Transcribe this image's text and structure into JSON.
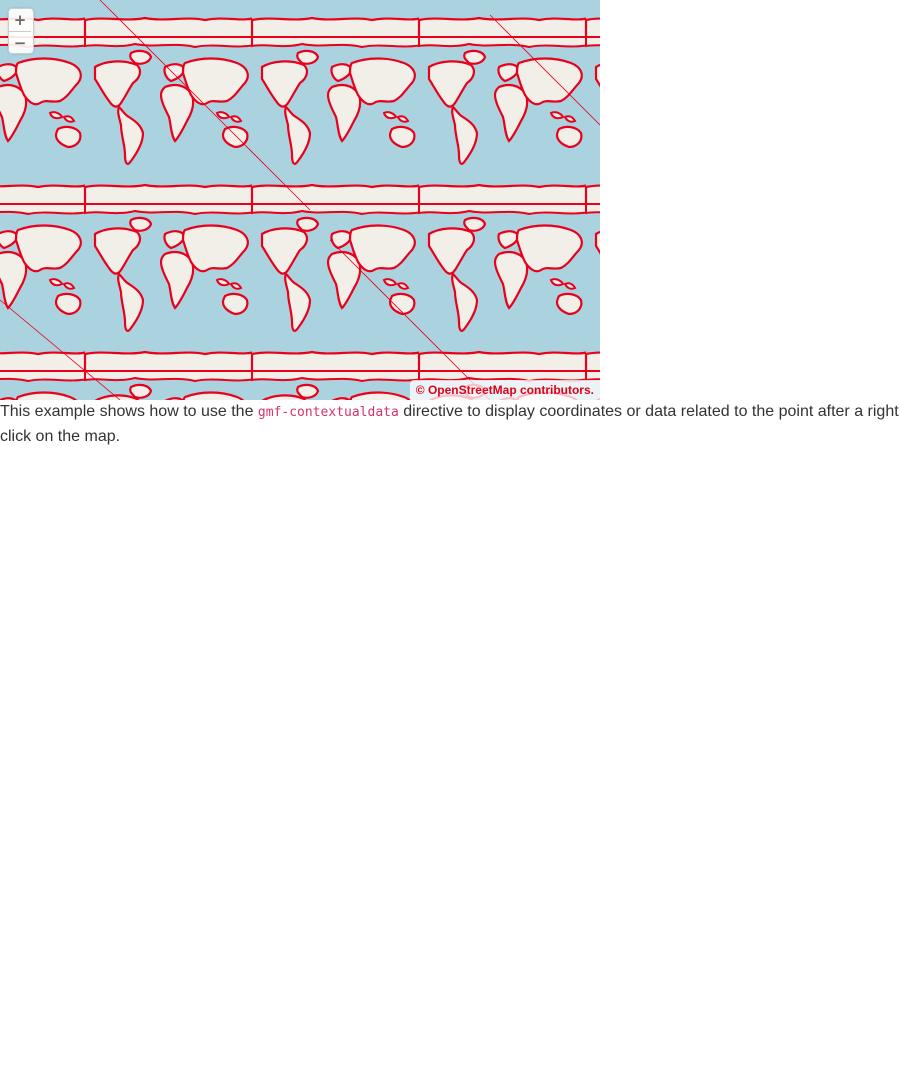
{
  "map": {
    "zoom_in_label": "+",
    "zoom_out_label": "−",
    "attribution": "© OpenStreetMap contributors.",
    "colors": {
      "ocean": "#aad3df",
      "land": "#f2efe9",
      "border": "#e8001c"
    }
  },
  "description": {
    "before": "This example shows how to use the",
    "code": "gmf-contextualdata",
    "after": "directive to display coordinates or data related to the point after a right click on the map."
  }
}
